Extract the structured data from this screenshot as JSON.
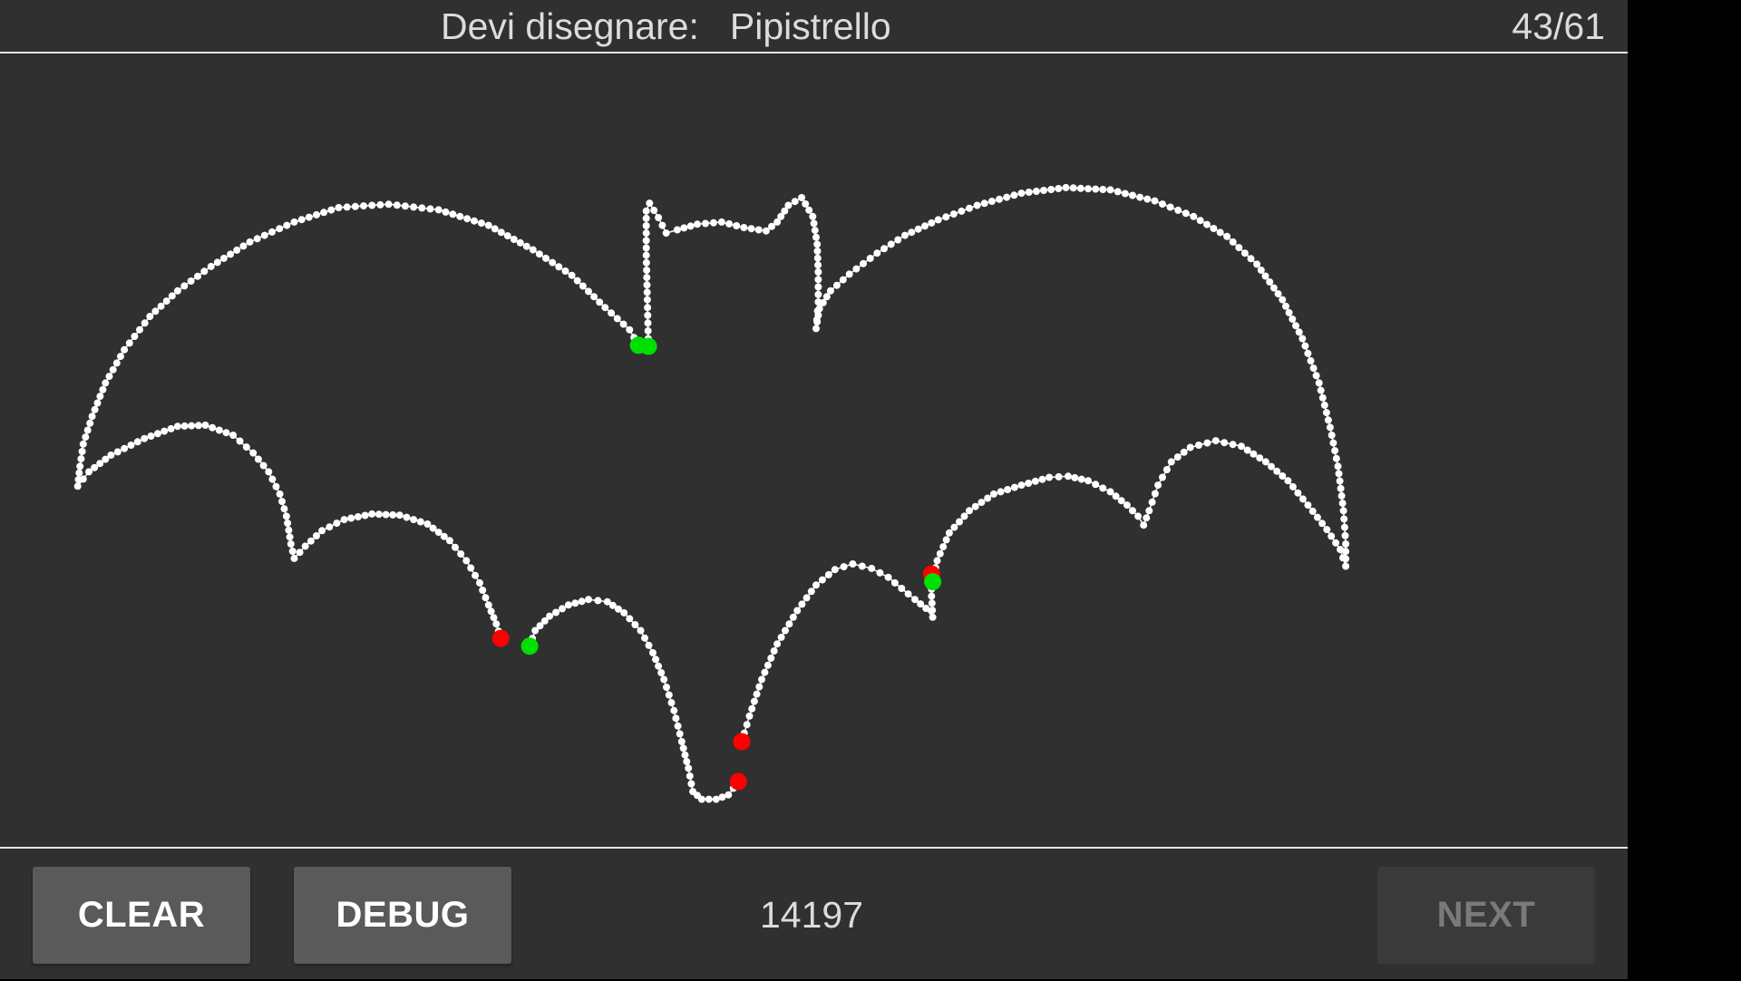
{
  "header": {
    "prompt_label": "Devi disegnare:",
    "target_word": "Pipistrello",
    "progress": "43/61"
  },
  "canvas": {
    "stroke_color": "#ffffff",
    "start_marker_color": "#00e000",
    "end_marker_color": "#ff0000",
    "background": "#303030"
  },
  "footer": {
    "clear_label": "CLEAR",
    "debug_label": "DEBUG",
    "score": "14197",
    "next_label": "NEXT"
  }
}
